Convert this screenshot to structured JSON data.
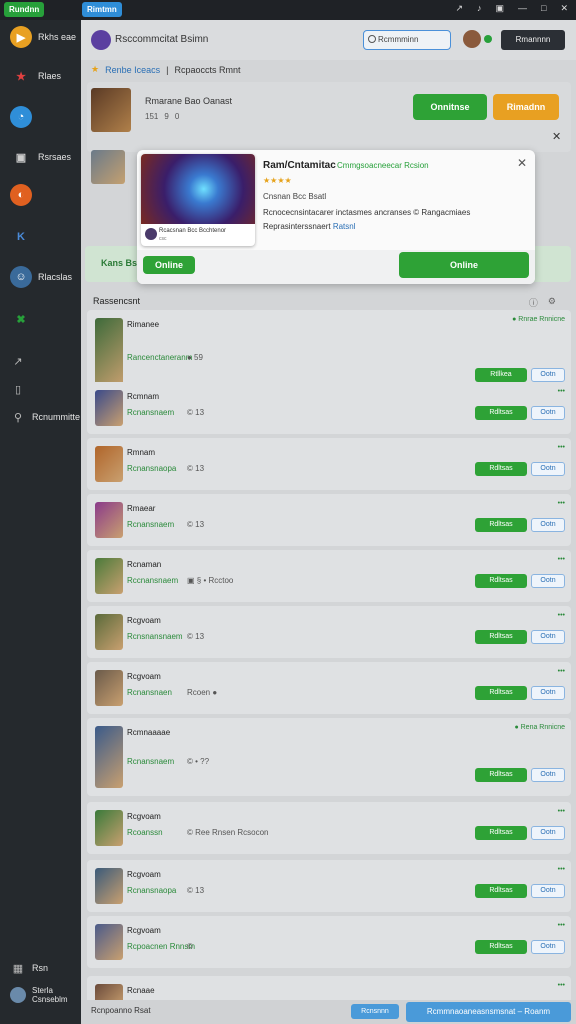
{
  "topbar": {
    "badge_left": "Rundnn",
    "badge_mid": "Rimtmn",
    "icons": [
      "pin-icon",
      "bell-icon",
      "gift-icon",
      "minimize-icon",
      "maximize-icon",
      "close-icon"
    ],
    "icon_labels": [
      "↗",
      "♪",
      "▣",
      "—",
      "□",
      "✕"
    ]
  },
  "sidebar": {
    "items": [
      {
        "label": "Rkhs eae",
        "color": "#e8a022",
        "glyph": "▶"
      },
      {
        "label": "Rlaes",
        "color": "#c93a3a",
        "glyph": "★"
      },
      {
        "label": "",
        "color": "#2f8ed8",
        "glyph": "◔"
      },
      {
        "label": "Rsrsaes",
        "color": "#25292d",
        "glyph": "▣"
      },
      {
        "label": "",
        "color": "#e06020",
        "glyph": "◐"
      },
      {
        "label": "",
        "color": "#2f6ed8",
        "glyph": "K"
      },
      {
        "label": "Rlacslas",
        "color": "#3a6a9a",
        "glyph": "☺"
      },
      {
        "label": "",
        "color": "#27a03a",
        "glyph": "✖"
      },
      {
        "label": "",
        "color": "#25292d",
        "glyph": "↗"
      },
      {
        "label": "",
        "color": "#25292d",
        "glyph": "▯"
      },
      {
        "label": "Rcnummitte",
        "color": "#25292d",
        "glyph": "⚲"
      }
    ],
    "bottom_label1": "Rsn",
    "bottom_label2": "Sterla",
    "bottom_label3": "Csnseblm"
  },
  "header": {
    "title": "Rsccommcitat Bsimn",
    "search_text": "Rcmmminn",
    "account_button": "Rmannnn"
  },
  "breadcrumb": {
    "link": "Renbe Iceacs",
    "separator": "|",
    "text": "Rcpaoccts Rmnt"
  },
  "featured": {
    "title": "Rmarane Bao Oanast",
    "meta": [
      "151",
      "9",
      "0"
    ],
    "online_button": "Onnitnse",
    "orange_button": "Rimadnn"
  },
  "modal": {
    "card_caption": "Rcacsnan Bcc Bcchtenor",
    "card_caption2": "csc",
    "title": "Ram/Cntamitac",
    "subtitle": "Cmmgsoacneecar Rcsion",
    "rating": "★★★★",
    "line1": "Cnsnan Bcc Bsatl",
    "line2": "Rcnocecnsintacarer inctasmes ancranses © Rangacmiaes",
    "line3_text": "Reprasinterssnaert",
    "line3_link": "Ratsnl",
    "online_left": "Online",
    "online_right": "Online"
  },
  "banner": {
    "text": "Kans Bs"
  },
  "list": {
    "header": "Rassencsnt",
    "rows": [
      {
        "title": "Rimanee",
        "sub": "Rancenctaneranm",
        "extra": "● 59",
        "badge": "● Rnrae Rnnicne",
        "button": "Rtllkea",
        "button2": "Ootn",
        "thumb": "#3d6a3a"
      },
      {
        "title": "Rcmnam",
        "sub": "Rcnansnaem",
        "extra": "© 13",
        "badge": "•••",
        "button": "Rdltsas",
        "button2": "Ootn",
        "thumb": "#3a4a8a"
      },
      {
        "title": "Rmnam",
        "sub": "Rcnansnaopa",
        "extra": "© 13",
        "badge": "•••",
        "button": "Rdltsas",
        "button2": "Ootn",
        "thumb": "#b0652a"
      },
      {
        "title": "Rmaear",
        "sub": "Rcnansnaem",
        "extra": "© 13",
        "badge": "•••",
        "button": "Rdltsas",
        "button2": "Ootn",
        "thumb": "#8a3a8a"
      },
      {
        "title": "Rcnaman",
        "sub": "Rccnansnaem",
        "extra": "▣ § • Rcctoo",
        "badge": "•••",
        "button": "Rdltsas",
        "button2": "Ootn",
        "thumb": "#4a7a3a"
      },
      {
        "title": "Rcgvoam",
        "sub": "Rcnsnansnaem",
        "extra": "© 13",
        "badge": "•••",
        "button": "Rdltsas",
        "button2": "Ootn",
        "thumb": "#5a6a3a"
      },
      {
        "title": "Rcgvoam",
        "sub": "Rcnansnaen",
        "extra": "Rcoen ●",
        "badge": "•••",
        "button": "Rdltsas",
        "button2": "Ootn",
        "thumb": "#6a5a4a"
      },
      {
        "title": "Rcmnaaaae",
        "sub": "Rcnansnaem",
        "extra": "© • ??",
        "badge": "● Rena Rnnicne",
        "button": "Rdltsas",
        "button2": "Ootn",
        "thumb": "#3a5a8a"
      },
      {
        "title": "Rcgvoam",
        "sub": "Rcoanssn",
        "extra": "© Ree Rnsen Rcsocon",
        "badge": "•••",
        "button": "Rdltsas",
        "button2": "Ootn",
        "thumb": "#3a7a3a"
      },
      {
        "title": "Rcgvoam",
        "sub": "Rcnansnaopa",
        "extra": "© 13",
        "badge": "•••",
        "button": "Rdltsas",
        "button2": "Ootn",
        "thumb": "#3a5a7a"
      },
      {
        "title": "Rcgvoam",
        "sub": "Rcpoacnen Rnnsm",
        "extra": "©",
        "badge": "•••",
        "button": "Rdltsas",
        "button2": "Ootn",
        "thumb": "#4a5a8a"
      },
      {
        "title": "Rcnaae",
        "sub": "",
        "extra": "",
        "badge": "•••",
        "button": "",
        "button2": "",
        "thumb": "#6a4a3a"
      }
    ]
  },
  "bottombar": {
    "left": "Rcnpoanno Rsat",
    "button1": "Rcnsnnn",
    "button2": "Rcmmnaoaneasnsmsnat – Roanm"
  }
}
